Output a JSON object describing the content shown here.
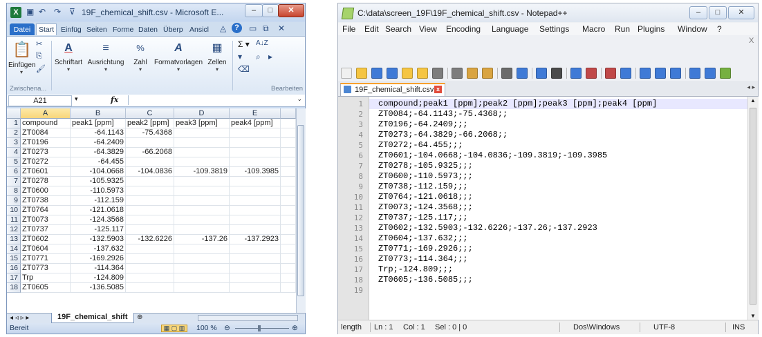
{
  "excel": {
    "title": "19F_chemical_shift.csv - Microsoft E...",
    "logo": "X",
    "qa_icons": [
      "save-icon",
      "undo-icon",
      "redo-icon",
      "customize-icon"
    ],
    "caption_buttons": [
      "–",
      "□",
      "✕"
    ],
    "tabs": [
      "Datei",
      "Start",
      "Einfüg",
      "Seiten",
      "Forme",
      "Daten",
      "Überp",
      "Ansicl"
    ],
    "tab_right_icons": [
      "◬",
      "?",
      "▭",
      "⧉",
      "✕"
    ],
    "ribbon": {
      "paste_label": "Einfügen",
      "clipboard_group": "Zwischena...",
      "font_label": "Schriftart",
      "align_label": "Ausrichtung",
      "number_label": "Zahl",
      "styles_label": "Formatvorlagen",
      "cells_label": "Zellen",
      "editing_group": "Bearbeiten",
      "sigma": "Σ ▾",
      "sort": "A↓Z",
      "find": "⩿",
      "clear": "⫴"
    },
    "namebox": "A21",
    "fx": "fx",
    "columns": [
      "A",
      "B",
      "C",
      "D",
      "E"
    ],
    "rows": [
      [
        "compound",
        "peak1 [ppm]",
        "peak2 [ppm]",
        "peak3 [ppm]",
        "peak4 [ppm]"
      ],
      [
        "ZT0084",
        "-64.1143",
        "-75.4368",
        "",
        ""
      ],
      [
        "ZT0196",
        "-64.2409",
        "",
        "",
        ""
      ],
      [
        "ZT0273",
        "-64.3829",
        "-66.2068",
        "",
        ""
      ],
      [
        "ZT0272",
        "-64.455",
        "",
        "",
        ""
      ],
      [
        "ZT0601",
        "-104.0668",
        "-104.0836",
        "-109.3819",
        "-109.3985"
      ],
      [
        "ZT0278",
        "-105.9325",
        "",
        "",
        ""
      ],
      [
        "ZT0600",
        "-110.5973",
        "",
        "",
        ""
      ],
      [
        "ZT0738",
        "-112.159",
        "",
        "",
        ""
      ],
      [
        "ZT0764",
        "-121.0618",
        "",
        "",
        ""
      ],
      [
        "ZT0073",
        "-124.3568",
        "",
        "",
        ""
      ],
      [
        "ZT0737",
        "-125.117",
        "",
        "",
        ""
      ],
      [
        "ZT0602",
        "-132.5903",
        "-132.6226",
        "-137.26",
        "-137.2923"
      ],
      [
        "ZT0604",
        "-137.632",
        "",
        "",
        ""
      ],
      [
        "ZT0771",
        "-169.2926",
        "",
        "",
        ""
      ],
      [
        "ZT0773",
        "-114.364",
        "",
        "",
        ""
      ],
      [
        "Trp",
        "-124.809",
        "",
        "",
        ""
      ],
      [
        "ZT0605",
        "-136.5085",
        "",
        "",
        ""
      ]
    ],
    "row_numbers": [
      "1",
      "2",
      "3",
      "4",
      "5",
      "6",
      "7",
      "8",
      "9",
      "10",
      "11",
      "12",
      "13",
      "14",
      "15",
      "16",
      "17",
      "18"
    ],
    "sheet_tab": "19F_chemical_shift",
    "sheet_nav": "◂ ◃ ▹ ▸",
    "status_left": "Bereit",
    "zoom": "100 %"
  },
  "notepad": {
    "title": "C:\\data\\screen_19F\\19F_chemical_shift.csv - Notepad++",
    "caption_buttons": [
      "–",
      "□",
      "✕"
    ],
    "menu": [
      "File",
      "Edit",
      "Search",
      "View",
      "Encoding",
      "Language",
      "Settings",
      "Macro",
      "Run",
      "Plugins",
      "Window",
      "?"
    ],
    "menu_close": "X",
    "tab": "19F_chemical_shift.csv",
    "tab_close": "x",
    "tab_arrows": "◂ ▸",
    "line_numbers": [
      "1",
      "2",
      "3",
      "4",
      "5",
      "6",
      "7",
      "8",
      "9",
      "10",
      "11",
      "12",
      "13",
      "14",
      "15",
      "16",
      "17",
      "18",
      "19"
    ],
    "lines": [
      "compound;peak1 [ppm];peak2 [ppm];peak3 [ppm];peak4 [ppm]",
      "ZT0084;-64.1143;-75.4368;;",
      "ZT0196;-64.2409;;;",
      "ZT0273;-64.3829;-66.2068;;",
      "ZT0272;-64.455;;;",
      "ZT0601;-104.0668;-104.0836;-109.3819;-109.3985",
      "ZT0278;-105.9325;;;",
      "ZT0600;-110.5973;;;",
      "ZT0738;-112.159;;;",
      "ZT0764;-121.0618;;;",
      "ZT0073;-124.3568;;;",
      "ZT0737;-125.117;;;",
      "ZT0602;-132.5903;-132.6226;-137.26;-137.2923",
      "ZT0604;-137.632;;;",
      "ZT0771;-169.2926;;;",
      "ZT0773;-114.364;;;",
      "Trp;-124.809;;;",
      "ZT0605;-136.5085;;;",
      ""
    ],
    "status": {
      "length": "length",
      "ln": "Ln : 1",
      "col": "Col : 1",
      "sel": "Sel : 0 | 0",
      "eol": "Dos\\Windows",
      "encoding": "UTF-8",
      "mode": "INS"
    }
  }
}
